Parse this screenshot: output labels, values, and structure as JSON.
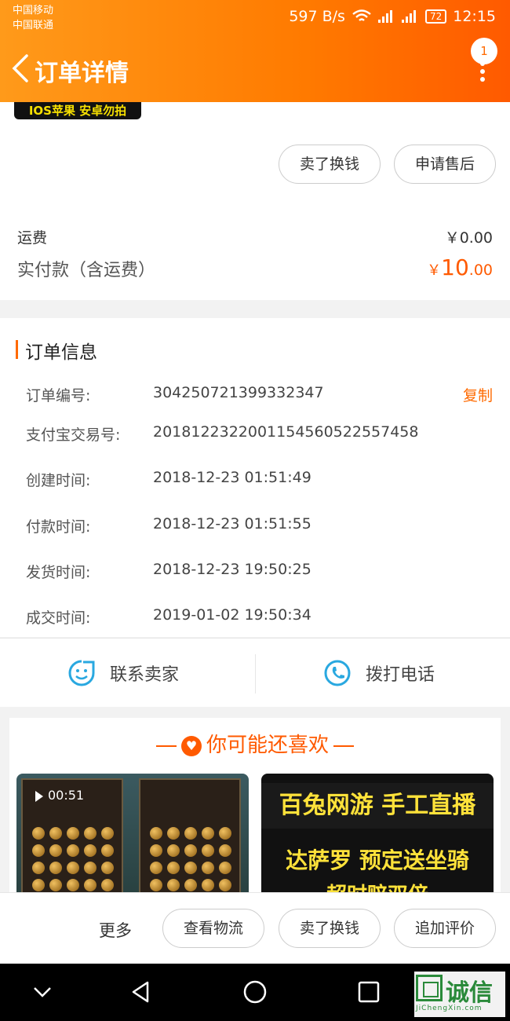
{
  "status_bar": {
    "carrier1": "中国移动",
    "carrier2": "中国联通",
    "speed": "597 B/s",
    "net1": "2G",
    "net2": "4G",
    "battery": "72",
    "time": "12:15"
  },
  "header": {
    "title": "订单详情",
    "notification_count": "1"
  },
  "product": {
    "promo_text": "IOS苹果 安卓勿拍",
    "btn_sell": "卖了换钱",
    "btn_aftersale": "申请售后"
  },
  "fees": {
    "shipping_label": "运费",
    "shipping_value": "￥0.00",
    "paid_label": "实付款（含运费）",
    "paid_currency": "￥",
    "paid_int": "10",
    "paid_dec": ".00"
  },
  "order_info": {
    "title": "订单信息",
    "copy_label": "复制",
    "rows": [
      {
        "key": "订单编号:",
        "value": "304250721399332347"
      },
      {
        "key": "支付宝交易号:",
        "value": "2018122322001154560522557458"
      },
      {
        "key": "创建时间:",
        "value": "2018-12-23 01:51:49"
      },
      {
        "key": "付款时间:",
        "value": "2018-12-23 01:51:55"
      },
      {
        "key": "发货时间:",
        "value": "2018-12-23 19:50:25"
      },
      {
        "key": "成交时间:",
        "value": "2019-01-02 19:50:34"
      }
    ]
  },
  "contact": {
    "seller": "联系卖家",
    "call": "拨打电话"
  },
  "recommend": {
    "title": "你可能还喜欢",
    "video_duration": "00:51",
    "ad_line1": "百兔网游 手工直播",
    "ad_line2": "达萨罗 预定送坐骑",
    "ad_line3": "超时赔双倍"
  },
  "actions": {
    "more": "更多",
    "logistics": "查看物流",
    "sell": "卖了换钱",
    "review": "追加评价"
  },
  "watermark": {
    "text": "诚信",
    "sub": "JiChengXin.com"
  },
  "colors": {
    "accent": "#ff6a00",
    "price": "#ff5a00"
  }
}
